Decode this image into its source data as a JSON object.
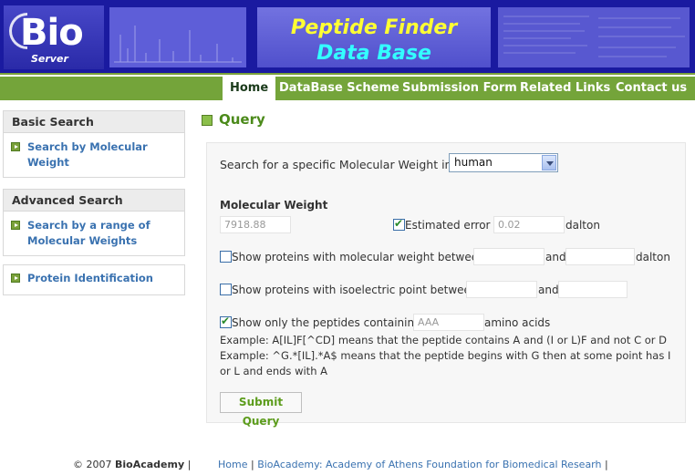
{
  "header": {
    "logo_text": "Bio",
    "logo_sub": "Server",
    "title_line1": "Peptide Finder",
    "title_line2": "Data Base",
    "colors": {
      "banner": "#1a1aa0",
      "title1": "#ffff33",
      "title2": "#33ffff"
    }
  },
  "nav": {
    "items": [
      "Home",
      "DataBase Scheme",
      "Submission Form",
      "Related Links",
      "Contact us"
    ],
    "active": "Home",
    "color": "#74a43a"
  },
  "sidebar": {
    "basic_heading": "Basic Search",
    "basic_link": "Search by Molecular Weight",
    "advanced_heading": "Advanced Search",
    "advanced_link": "Search by a range of Molecular Weights",
    "protein_link": "Protein Identification"
  },
  "query": {
    "title": "Query",
    "search_label": "Search for a specific Molecular Weight in",
    "organism": "human",
    "mw_heading": "Molecular Weight",
    "mw_value": "7918.88",
    "est_error_label": "Estimated error :",
    "est_error_value": "0.02",
    "est_error_checked": true,
    "dalton": "dalton",
    "between_mw_label": "Show proteins with molecular weight between",
    "and": "and",
    "between_pi_label": "Show proteins with isoelectric point between",
    "peptide_label": "Show only the peptides containing",
    "peptide_value": "AAA",
    "peptide_checked": true,
    "amino_acids": "amino acids",
    "example1": "Example: A[IL]F[^CD] means that the peptide contains A and (I or L)F and not C or D",
    "example2": "Example: ^G.*[IL].*A$ means that the peptide begins with G then at some point has I or L and ends with A",
    "submit": "Submit Query"
  },
  "footer": {
    "copyright": "© 2007",
    "brand": "BioAcademy",
    "sep": "|",
    "home": "Home",
    "academy": "BioAcademy: Academy of Athens Foundation for Biomedical Researh"
  }
}
